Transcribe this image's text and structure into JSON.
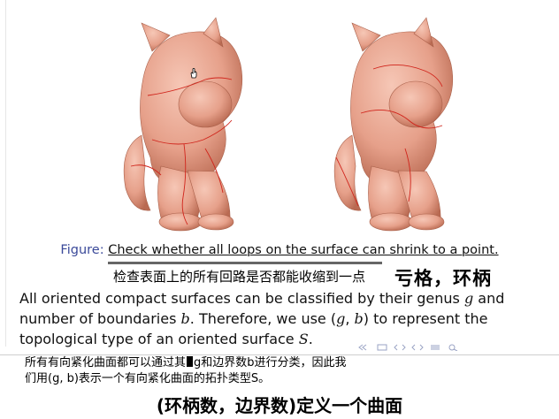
{
  "caption": {
    "label": "Figure:",
    "text": "Check whether all loops on the surface can shrink to a point."
  },
  "subtitle_line1": "检查表面上的所有回路是否都能收缩到一点",
  "note_genus": "亏格，环柄",
  "body": {
    "line1_a": "All oriented compact surfaces can be classified by their genus ",
    "line1_g": "g",
    "line1_b": " and",
    "line2_a": "number of boundaries ",
    "line2_b_var": "b",
    "line2_c": ". Therefore, we use (",
    "line2_g": "g",
    "line2_comma": ", ",
    "line2_b2": "b",
    "line2_d": ") to represent the",
    "line3_a": "topological type of an oriented surface ",
    "line3_s": "S",
    "line3_b": "."
  },
  "overlay_subtitle": {
    "line1_a": "所有有向紧化曲面都可以通过其",
    "line1_b": "g和边界数b进行分类，因此我",
    "line2": "们用(g, b)表示一个有向紧化曲面的拓扑类型S。"
  },
  "big_subtitle": "(环柄数，边界数)定义一个曲面",
  "colors": {
    "cat_skin": "#e9a58f",
    "cat_shadow": "#b9674f",
    "loop": "#d0241b",
    "figure_label": "#3b4a9a"
  },
  "icons": [
    "cat-model-left",
    "cat-model-right",
    "hand-cursor-icon",
    "beamer-nav-icons"
  ]
}
